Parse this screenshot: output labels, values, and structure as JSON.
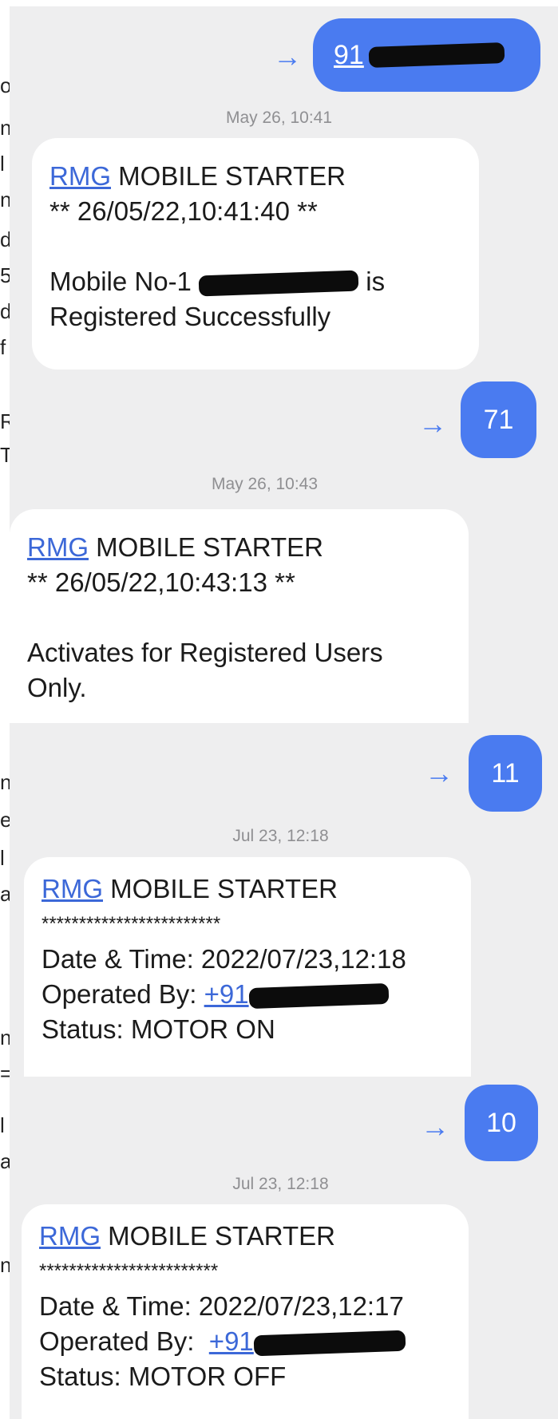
{
  "left_text": [
    "o",
    "n",
    "l",
    "n",
    "d",
    "5",
    "d",
    "f",
    "R",
    "T",
    "n",
    "e",
    "l",
    "a",
    "n",
    "=",
    "l",
    "a",
    "n"
  ],
  "messages": [
    {
      "sent": "91",
      "time": "May 26, 10:41",
      "reply": {
        "sender": "RMG",
        "title": "MOBILE STARTER",
        "line1": "** 26/05/22,10:41:40 **",
        "mobile_prefix": "Mobile No-1",
        "mobile_suffix": "is",
        "line_last": "Registered Successfully"
      }
    },
    {
      "sent": "71",
      "time": "May 26, 10:43",
      "reply": {
        "sender": "RMG",
        "title": "MOBILE STARTER",
        "line1": "** 26/05/22,10:43:13 **",
        "line2": "Activates for Registered Users",
        "line3": "Only."
      }
    },
    {
      "sent": "11",
      "time": "Jul 23, 12:18",
      "reply": {
        "sender": "RMG",
        "title": "MOBILE STARTER",
        "stars": "************************",
        "datetime": "Date & Time: 2022/07/23,12:18",
        "operated_label": "Operated By:",
        "operated_num": "+91",
        "status": "Status: MOTOR ON"
      }
    },
    {
      "sent": "10",
      "time": "Jul 23, 12:18",
      "reply": {
        "sender": "RMG",
        "title": "MOBILE STARTER",
        "stars": "************************",
        "datetime": "Date & Time: 2022/07/23,12:17",
        "operated_label": "Operated By:",
        "operated_num": "+91",
        "status": "Status: MOTOR OFF"
      }
    }
  ],
  "colors": {
    "accent": "#4a7bf0",
    "panel": "#eeeeef",
    "link": "#3c68d8"
  },
  "icons": {
    "sent_arrow": "arrow-right-icon"
  }
}
